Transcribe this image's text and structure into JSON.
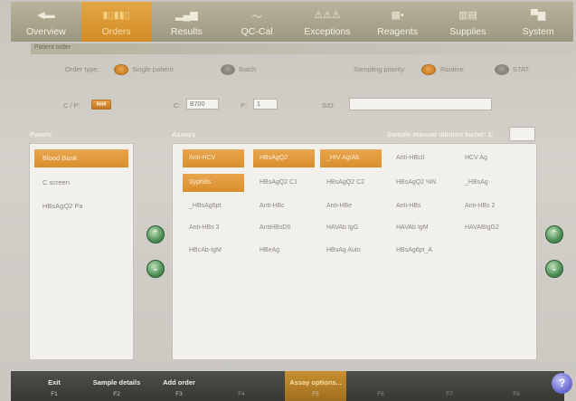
{
  "nav": {
    "tabs": [
      {
        "label": "Overview",
        "icon": "back-arrow-icon"
      },
      {
        "label": "Orders",
        "icon": "barcode-icon"
      },
      {
        "label": "Results",
        "icon": "bar-chart-icon"
      },
      {
        "label": "QC-Cal",
        "icon": "wave-graph-icon"
      },
      {
        "label": "Exceptions",
        "icon": "warning-icon"
      },
      {
        "label": "Reagents",
        "icon": "reagent-pack-icon"
      },
      {
        "label": "Supplies",
        "icon": "supplies-icon"
      },
      {
        "label": "System",
        "icon": "system-icon"
      }
    ],
    "active": "Orders"
  },
  "patient_order": {
    "title": "Patient order",
    "order_type_label": "Order type:",
    "single_patient_label": "Single patient",
    "batch_label": "Batch",
    "sampling_priority_label": "Sampling priority:",
    "routine_label": "Routine",
    "stat_label": "STAT",
    "cp_label": "C / P:",
    "c_label": "C:",
    "c_value": "B700",
    "p_label": "P:",
    "p_value": "1",
    "sid_label": "SID:",
    "sid_value": ""
  },
  "panels": {
    "title": "Panels",
    "items": [
      "Blood Bank",
      "C screen",
      "HBsAgQ2 Pa"
    ],
    "selected": "Blood Bank"
  },
  "assays": {
    "title": "Assays",
    "dilution_label": "Sample manual dilution factor: 1:",
    "dilution_value": "",
    "rows": [
      [
        "Anti-HCV",
        "HBsAgQ2",
        "_HIV Ag/Ab",
        "Anti-HBcII",
        "HCV Ag"
      ],
      [
        "Syphilis",
        "HBsAgQ2 C1",
        "HBsAgQ2 C2",
        "HBsAgQ2 %N",
        "_HBsAg"
      ],
      [
        "_HBsAg6pt",
        "Anti-HBc",
        "Anti-HBe",
        "Anti-HBs",
        "Anti-HBs 2"
      ],
      [
        "Anti-HBs 3",
        "AntiHBsDII",
        "HAVAb IgG",
        "HAVAb IgM",
        "HAVABIgG2"
      ],
      [
        "HBcAb-IgM",
        "HBeAg",
        "HBsAg Auto",
        "HBsAg6pt_A"
      ]
    ],
    "selected": [
      "Anti-HCV",
      "HBsAgQ2",
      "_HIV Ag/Ab",
      "Syphilis"
    ]
  },
  "bottom_bar": {
    "keys": [
      {
        "label": "Exit",
        "key": "F1"
      },
      {
        "label": "Sample details",
        "key": "F2"
      },
      {
        "label": "Add order",
        "key": "F3"
      },
      {
        "label": "",
        "key": "F4"
      },
      {
        "label": "Assay options...",
        "key": "F5"
      },
      {
        "label": "",
        "key": "F6"
      },
      {
        "label": "",
        "key": "F7"
      },
      {
        "label": "",
        "key": "F8"
      }
    ],
    "help_label": "?"
  },
  "colors": {
    "accent": "#d98e2c",
    "scroll": "#4f8f57",
    "help": "#6f72d6"
  }
}
